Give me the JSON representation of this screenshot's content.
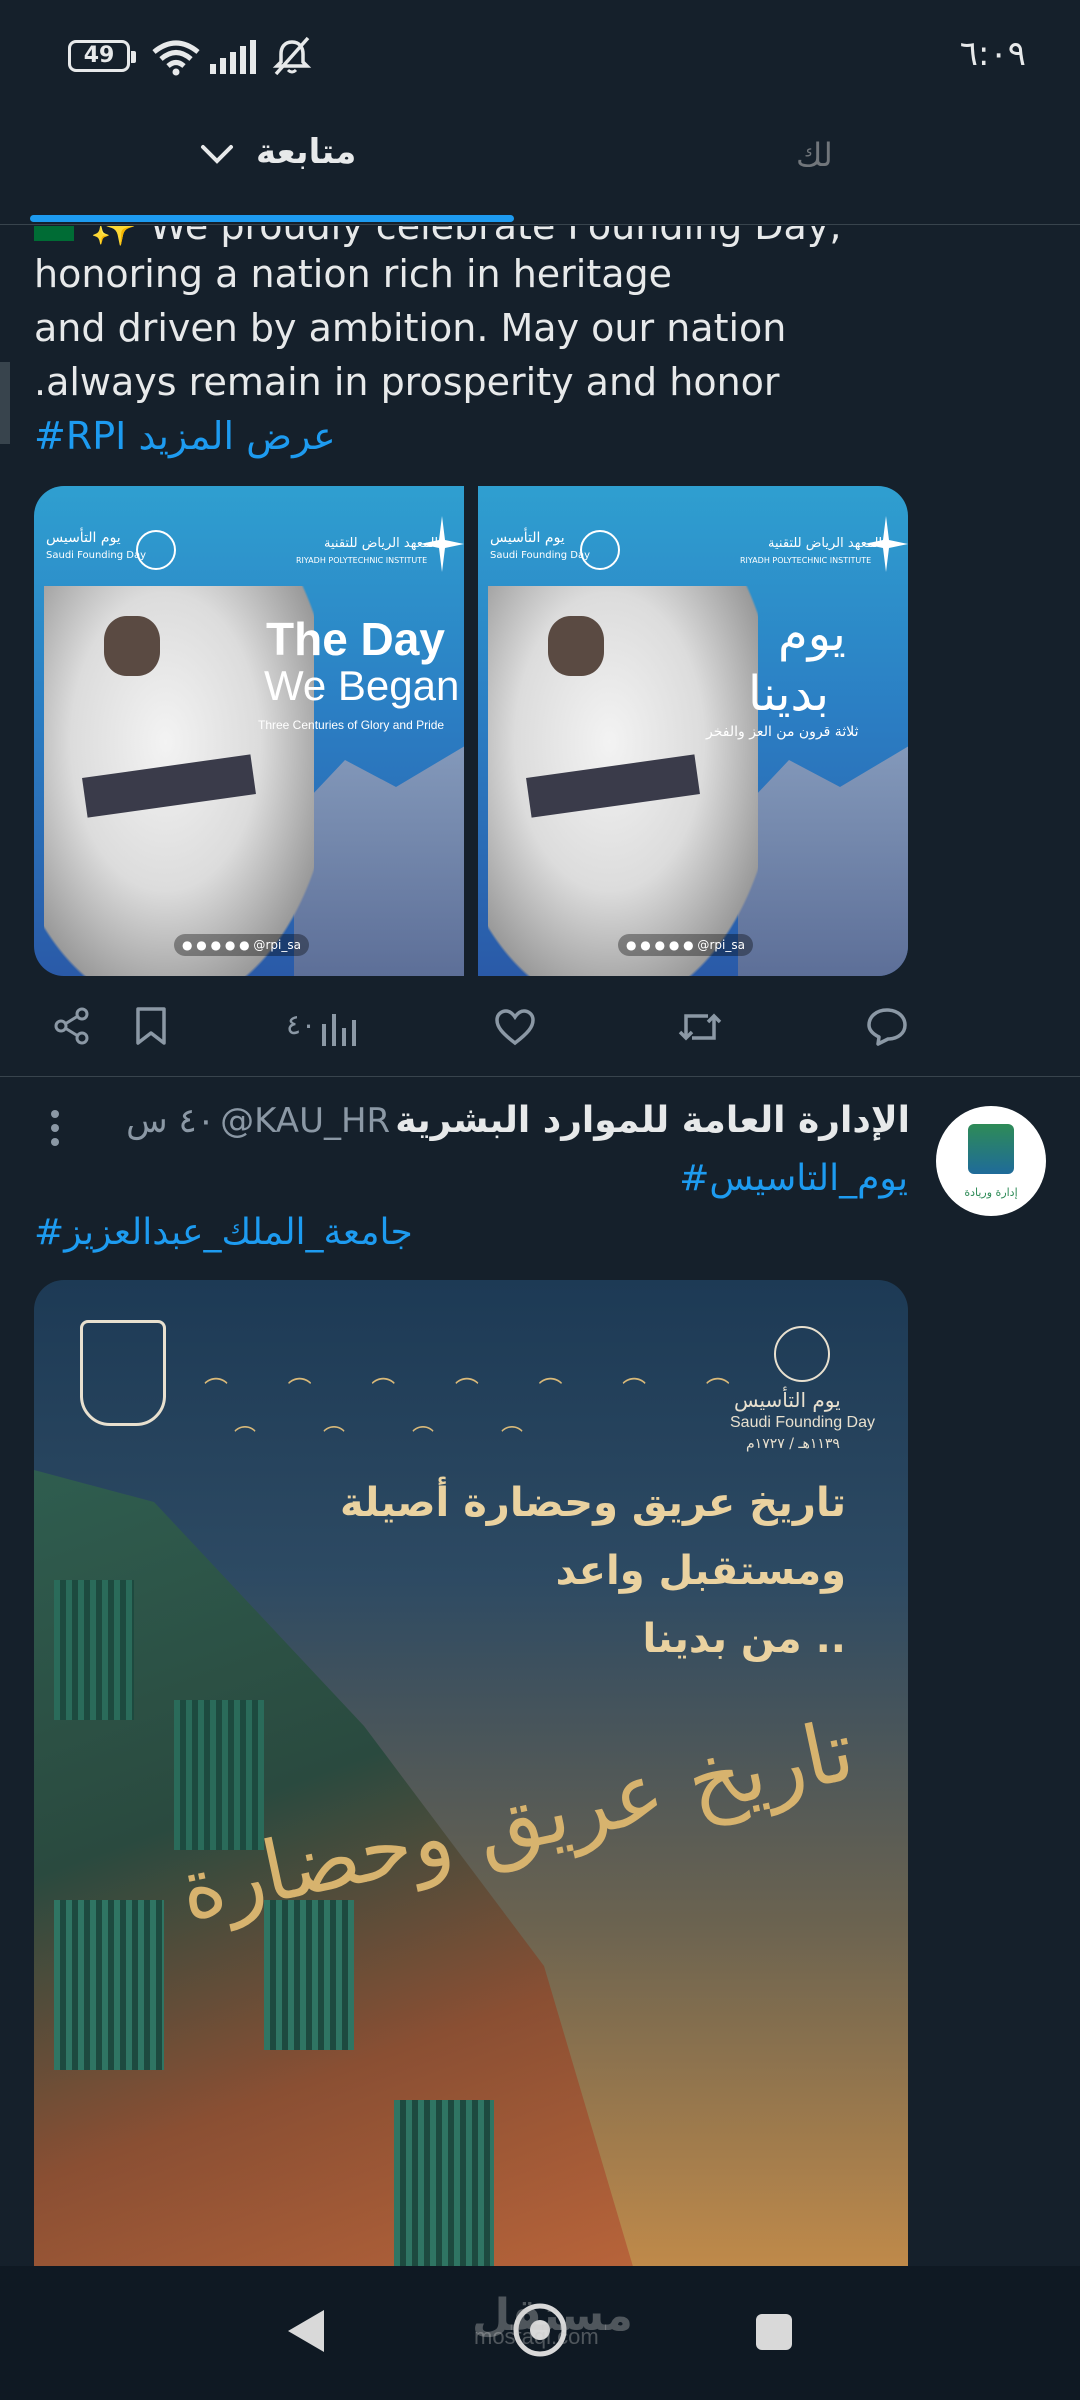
{
  "status_bar": {
    "battery": "49",
    "time": "٦:٠٩"
  },
  "top_tabs": {
    "following": "متابعة",
    "for_you": "لك"
  },
  "tweet1": {
    "lines": [
      "We proudly celebrate Founding Day,",
      "honoring a nation rich in heritage",
      "and driven by ambition. May our nation",
      ".always remain in prosperity and honor"
    ],
    "hashtag": "#RPI",
    "show_more": "عرض المزيد",
    "images": [
      {
        "title_line1": "The Day",
        "title_line2": "We Began",
        "subtitle": "Three Centuries of Glory and Pride",
        "handle": "rpi_sa",
        "institute_ar": "المعهد الرياض للتقنية",
        "institute_en": "RIYADH POLYTECHNIC INSTITUTE",
        "founding_ar": "يوم التأسيس",
        "founding_en": "Saudi Founding Day"
      },
      {
        "title_line1": "يوم",
        "title_line2": "بدينا",
        "subtitle": "ثلاثة قرون من العز والفخر",
        "handle": "rpi_sa",
        "institute_ar": "المعهد الرياض للتقنية",
        "institute_en": "RIYADH POLYTECHNIC INSTITUTE",
        "founding_ar": "يوم التأسيس",
        "founding_en": "Saudi Founding Day"
      }
    ],
    "views": "٤٠"
  },
  "tweet2": {
    "name": "الإدارة العامة للموارد البشرية",
    "handle": "@KAU_HR",
    "time": "٤٠ س",
    "hashtag1": "#يوم_التاسيس",
    "hashtag2": "#جامعة_الملك_عبدالعزيز",
    "image": {
      "founding_ar": "يوم التأسيس",
      "founding_en": "Saudi Founding Day",
      "dates": "١١٣٩هـ / ١٧٢٧م",
      "line1": "تاريخ عريق وحضارة أصيلة",
      "line2": "ومستقبل واعد",
      "line3": "من بدينا ..",
      "calligraphy": "تاريخ عريق وحضارة"
    },
    "avatar_caption": "إدارة وريادة"
  },
  "watermark": {
    "ar": "مستقل",
    "en": "mostaql.com"
  },
  "colors": {
    "background": "#15202b",
    "accent": "#1d9bf0",
    "muted": "#71767b"
  }
}
